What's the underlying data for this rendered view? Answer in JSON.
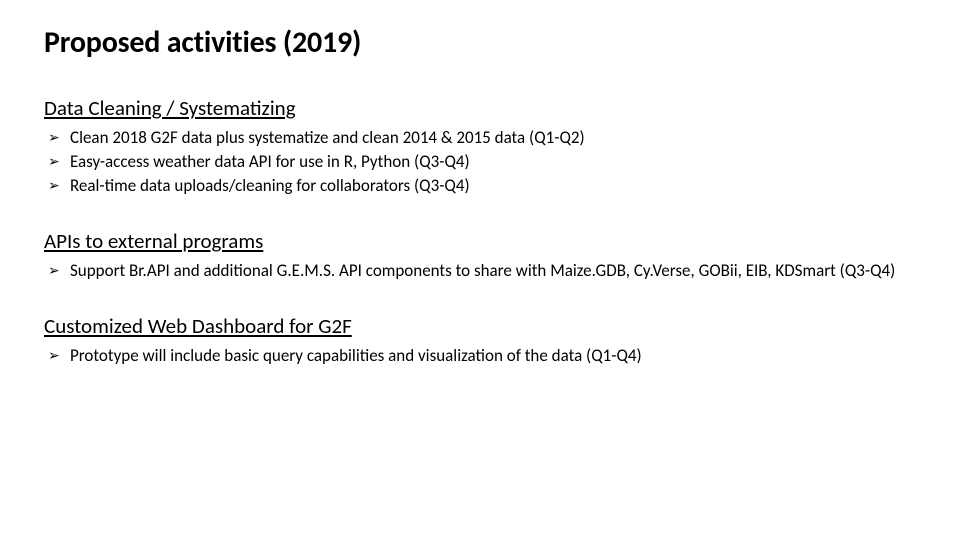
{
  "title": "Proposed activities (2019)",
  "sections": [
    {
      "heading": "Data Cleaning / Systematizing",
      "items": [
        "Clean 2018 G2F data plus systematize and clean 2014 & 2015 data (Q1-Q2)",
        "Easy-access weather data API for use in R, Python (Q3-Q4)",
        "Real-time data uploads/cleaning for collaborators (Q3-Q4)"
      ]
    },
    {
      "heading": "APIs to external programs",
      "items": [
        "Support Br.API and additional G.E.M.S. API components to share with Maize.GDB, Cy.Verse, GOBii, EIB, KDSmart (Q3-Q4)"
      ]
    },
    {
      "heading": "Customized Web Dashboard for G2F",
      "items": [
        "Prototype will include basic query capabilities and visualization of the data (Q1-Q4)"
      ]
    }
  ],
  "bullet_glyph": "➢"
}
